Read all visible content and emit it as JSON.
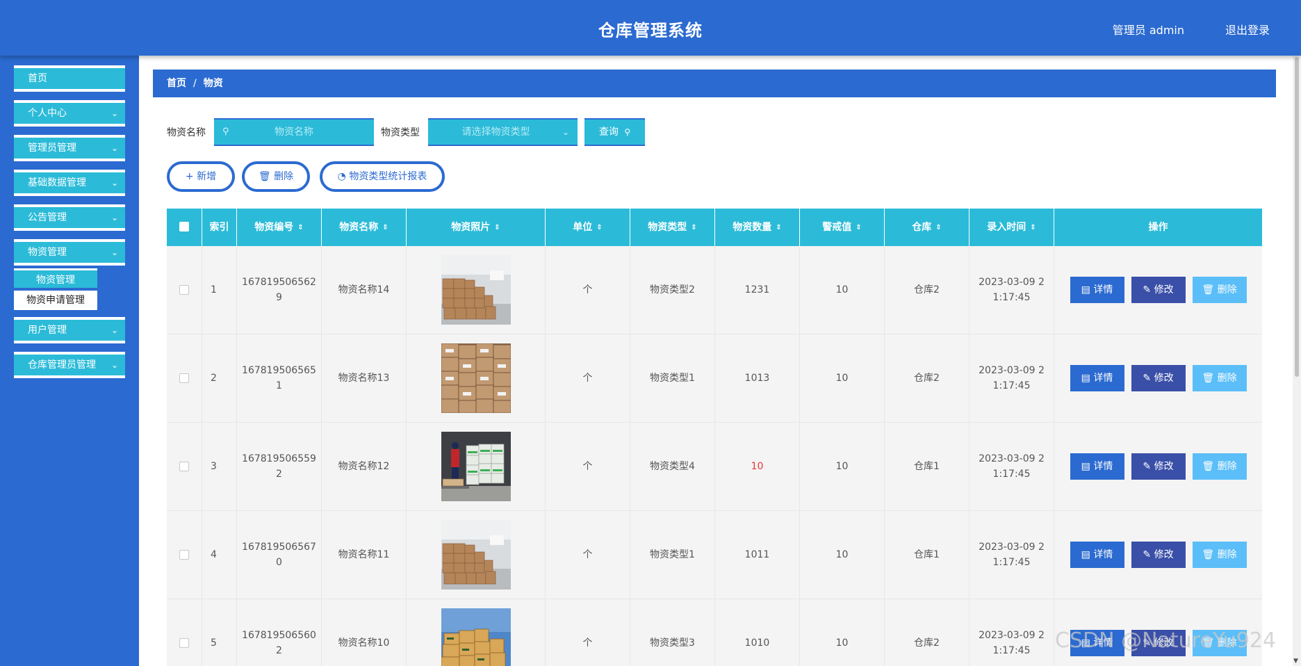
{
  "header": {
    "title": "仓库管理系统",
    "user": "管理员 admin",
    "logout": "退出登录"
  },
  "sidebar": {
    "items": [
      {
        "label": "首页",
        "chevron": false
      },
      {
        "label": "个人中心",
        "chevron": true
      },
      {
        "label": "管理员管理",
        "chevron": true
      },
      {
        "label": "基础数据管理",
        "chevron": true
      },
      {
        "label": "公告管理",
        "chevron": true
      },
      {
        "label": "物资管理",
        "chevron": true
      },
      {
        "label": "用户管理",
        "chevron": true
      },
      {
        "label": "仓库管理员管理",
        "chevron": true
      }
    ],
    "submenu": [
      "物资管理",
      "物资申请管理"
    ]
  },
  "breadcrumb": {
    "home": "首页",
    "separator": "/",
    "current": "物资"
  },
  "search": {
    "name_label": "物资名称",
    "name_placeholder": "物资名称",
    "type_label": "物资类型",
    "type_placeholder": "请选择物资类型",
    "query_button": "查询"
  },
  "actions": {
    "add": "新增",
    "delete": "删除",
    "report": "物资类型统计报表"
  },
  "table": {
    "headers": [
      "索引",
      "物资编号",
      "物资名称",
      "物资照片",
      "单位",
      "物资类型",
      "物资数量",
      "警戒值",
      "仓库",
      "录入时间",
      "操作"
    ],
    "row_actions": {
      "detail": "详情",
      "edit": "修改",
      "delete": "删除"
    },
    "rows": [
      {
        "index": "1",
        "code_line1": "167819506562",
        "code_line2": "9",
        "name": "物资名称14",
        "photo": "warehouse-boxes",
        "unit": "个",
        "type": "物资类型2",
        "qty": "1231",
        "qty_alert": false,
        "warn": "10",
        "warehouse": "仓库2",
        "time_line1": "2023-03-09 2",
        "time_line2": "1:17:45"
      },
      {
        "index": "2",
        "code_line1": "167819506565",
        "code_line2": "1",
        "name": "物资名称13",
        "photo": "stacked-cartons",
        "unit": "个",
        "type": "物资类型1",
        "qty": "1013",
        "qty_alert": false,
        "warn": "10",
        "warehouse": "仓库2",
        "time_line1": "2023-03-09 2",
        "time_line2": "1:17:45"
      },
      {
        "index": "3",
        "code_line1": "167819506559",
        "code_line2": "2",
        "name": "物资名称12",
        "photo": "workers-loading",
        "unit": "个",
        "type": "物资类型4",
        "qty": "10",
        "qty_alert": true,
        "warn": "10",
        "warehouse": "仓库1",
        "time_line1": "2023-03-09 2",
        "time_line2": "1:17:45"
      },
      {
        "index": "4",
        "code_line1": "167819506567",
        "code_line2": "0",
        "name": "物资名称11",
        "photo": "warehouse-boxes",
        "unit": "个",
        "type": "物资类型1",
        "qty": "1011",
        "qty_alert": false,
        "warn": "10",
        "warehouse": "仓库1",
        "time_line1": "2023-03-09 2",
        "time_line2": "1:17:45"
      },
      {
        "index": "5",
        "code_line1": "167819506560",
        "code_line2": "2",
        "name": "物资名称10",
        "photo": "outdoor-pallet",
        "unit": "个",
        "type": "物资类型3",
        "qty": "1010",
        "qty_alert": false,
        "warn": "10",
        "warehouse": "仓库2",
        "time_line1": "2023-03-09 2",
        "time_line2": "1:17:45"
      }
    ]
  },
  "watermark": "CSDN @NatureYu924",
  "colors": {
    "primary": "#2b6ad0",
    "accent": "#2bbbd8",
    "edit": "#3a4fa8",
    "delete": "#5bbef8",
    "alert": "#e53935"
  }
}
